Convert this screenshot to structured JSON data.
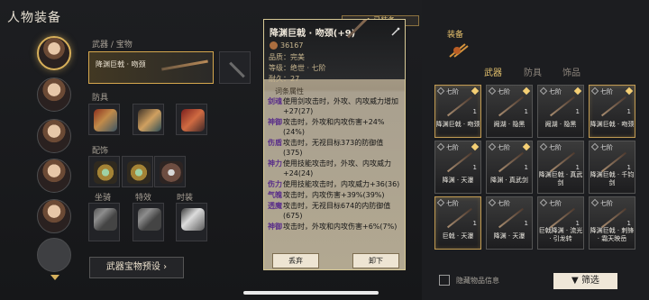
{
  "header": {
    "title": "人物装备"
  },
  "left": {
    "weapon_label": "武器 / 宝物",
    "weapon_name": "降渊巨戟 · 吻颈",
    "armor_label": "防具",
    "accessory_label": "配饰",
    "mount_label": "坐骑",
    "special_label": "特效",
    "outfit_label": "时装",
    "preset_button": "武器宝物预设"
  },
  "detail": {
    "equipped_tag": "◆ 已装备",
    "name": "降渊巨戟 · 吻颈(+9)",
    "power": "36167",
    "quality": "品质：完美",
    "level": "等级：绝世 · 七阶",
    "durability": "耐久：27",
    "attr_title": "词条属性",
    "attrs": [
      {
        "key": "剑魂",
        "text": "使用剑攻击时，外攻、内攻威力增加+27(27)"
      },
      {
        "key": "神御",
        "text": "攻击时，外攻和内攻伤害+24%(24%)"
      },
      {
        "key": "伤盾",
        "text": "攻击时，无视目标373的防御值(375)"
      },
      {
        "key": "神力",
        "text": "使用技能攻击时，外攻、内攻威力+24(24)"
      },
      {
        "key": "伤力",
        "text": "使用技能攻击时，内攻威力+36(36)"
      },
      {
        "key": "气魄",
        "text": "攻击时，内攻伤害+39%(39%)"
      },
      {
        "key": "透魔",
        "text": "攻击时，无视目标674的内防御值(675)"
      },
      {
        "key": "神御",
        "text": "攻击时，外攻和内攻伤害+6%(7%)"
      }
    ],
    "discard_button": "丢弃",
    "unequip_button": "卸下"
  },
  "right": {
    "section_title": "装备",
    "tabs": [
      "武器",
      "防具",
      "饰品"
    ],
    "items": [
      {
        "lvl": "七阶",
        "num": "1",
        "name": "降渊巨戟 · 吻颈"
      },
      {
        "lvl": "七阶",
        "num": "1",
        "name": "阙湖 · 隐黑"
      },
      {
        "lvl": "七阶",
        "num": "1",
        "name": "阙湖 · 隐黑"
      },
      {
        "lvl": "七阶",
        "num": "1",
        "name": "降渊巨戟 · 吻颈"
      },
      {
        "lvl": "七阶",
        "num": "1",
        "name": "降渊 · 天瀑"
      },
      {
        "lvl": "七阶",
        "num": "1",
        "name": "降渊 · 真武剑"
      },
      {
        "lvl": "七阶",
        "num": "1",
        "name": "降渊巨戟 · 真武剑"
      },
      {
        "lvl": "七阶",
        "num": "1",
        "name": "降渊巨戟 · 千钧剑"
      },
      {
        "lvl": "七阶",
        "num": "1",
        "name": "巨戟 · 天瀑"
      },
      {
        "lvl": "七阶",
        "num": "1",
        "name": "降渊 · 天瀑"
      },
      {
        "lvl": "七阶",
        "num": "1",
        "name": "巨戟降渊 · 流光 · 引龙转"
      },
      {
        "lvl": "七阶",
        "num": "1",
        "name": "降渊巨戟 · 刺锋 · 霜天映岳"
      }
    ],
    "hide_info": "隐藏物品信息",
    "filter_button": "筛选"
  },
  "colors": {
    "gold": "#d8b05a",
    "purple": "#5a2f89"
  }
}
